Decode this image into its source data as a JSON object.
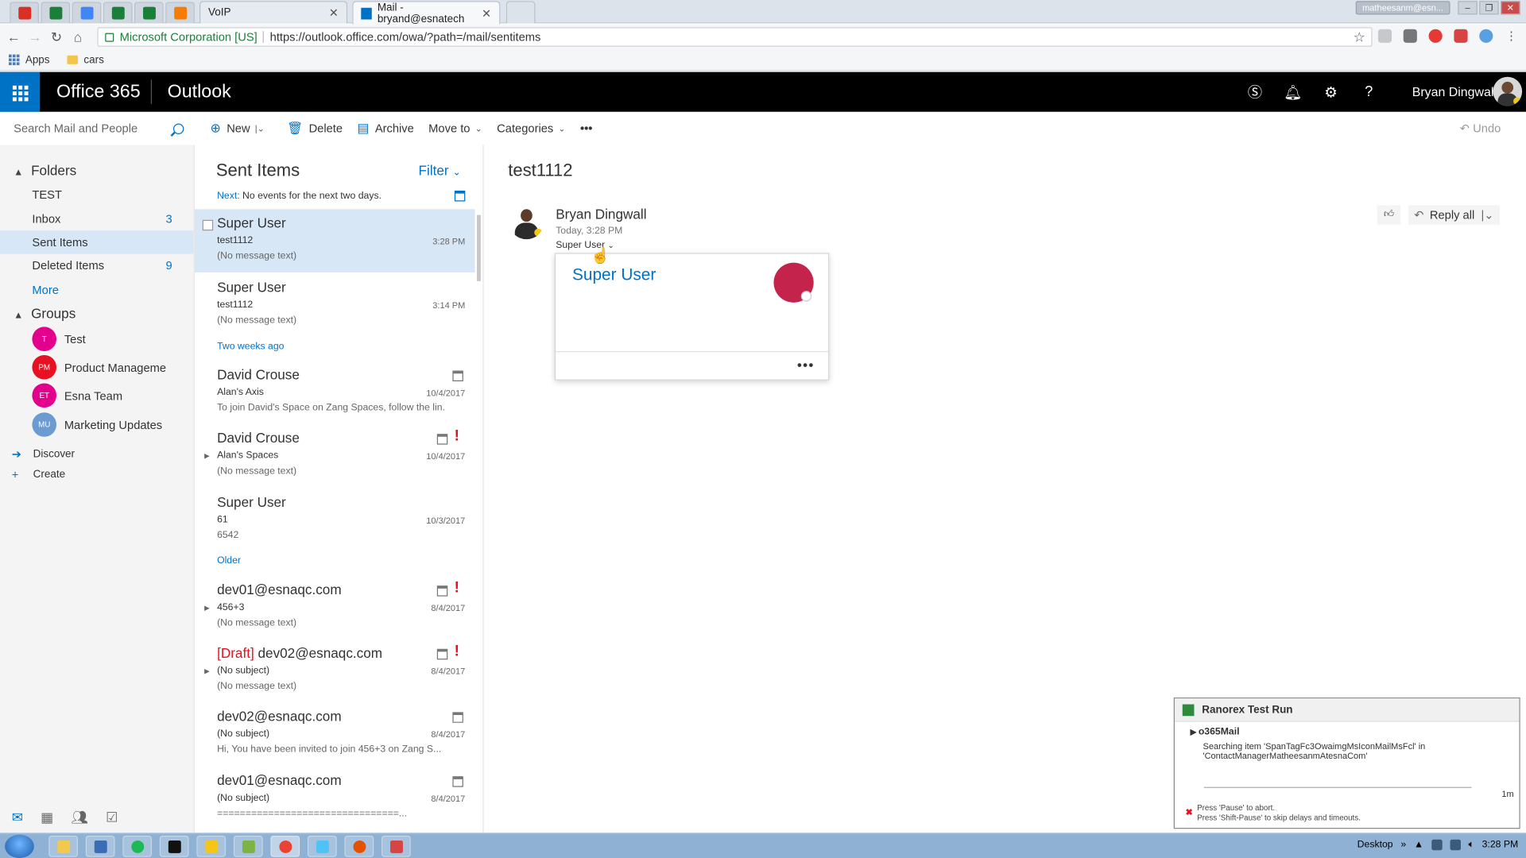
{
  "browser": {
    "tabs": [
      {
        "label": "VoIP"
      },
      {
        "label": "Mail - bryand@esnatech"
      }
    ],
    "profile_chip": "matheesanm@esn...",
    "address": {
      "org": "Microsoft Corporation [US]",
      "url": "https://outlook.office.com/owa/?path=/mail/sentitems"
    },
    "bookmarks": {
      "apps": "Apps",
      "folder": "cars"
    }
  },
  "suite": {
    "brand": "Office 365",
    "app": "Outlook",
    "user_name": "Bryan Dingwall"
  },
  "commands": {
    "search_placeholder": "Search Mail and People",
    "new": "New",
    "delete": "Delete",
    "archive": "Archive",
    "move_to": "Move to",
    "categories": "Categories",
    "more": "•••",
    "undo": "Undo"
  },
  "nav": {
    "folders_header": "Folders",
    "folders": [
      {
        "label": "TEST",
        "count": ""
      },
      {
        "label": "Inbox",
        "count": "3"
      },
      {
        "label": "Sent Items",
        "count": ""
      },
      {
        "label": "Deleted Items",
        "count": "9"
      }
    ],
    "more": "More",
    "groups_header": "Groups",
    "groups": [
      {
        "initials": "T",
        "label": "Test",
        "color": "#e3008c"
      },
      {
        "initials": "PM",
        "label": "Product Manageme",
        "color": "#e81123"
      },
      {
        "initials": "ET",
        "label": "Esna Team",
        "color": "#e3008c"
      },
      {
        "initials": "MU",
        "label": "Marketing Updates",
        "color": "#6b9bd1"
      }
    ],
    "discover": "Discover",
    "create": "Create"
  },
  "list": {
    "title": "Sent Items",
    "filter": "Filter",
    "next_label": "Next:",
    "next_text": "No events for the next two days.",
    "sections": {
      "two_weeks": "Two weeks ago",
      "older": "Older"
    },
    "messages": [
      {
        "from": "Super User",
        "subject": "test1112",
        "preview": "(No message text)",
        "date": "3:28 PM"
      },
      {
        "from": "Super User",
        "subject": "test1112",
        "preview": "(No message text)",
        "date": "3:14 PM"
      },
      {
        "from": "David Crouse",
        "subject": "Alan's Axis",
        "preview": "To join David's Space on Zang Spaces, follow the lin...",
        "date": "10/4/2017"
      },
      {
        "from": "David Crouse",
        "subject": "Alan's Spaces",
        "preview": "(No message text)",
        "date": "10/4/2017"
      },
      {
        "from": "Super User",
        "subject": "61",
        "preview": "6542",
        "date": "10/3/2017"
      },
      {
        "from": "dev01@esnaqc.com",
        "subject": "456+3",
        "preview": "(No message text)",
        "date": "8/4/2017"
      },
      {
        "draft": "[Draft]",
        "from": "dev02@esnaqc.com",
        "subject": "(No subject)",
        "preview": "(No message text)",
        "date": "8/4/2017"
      },
      {
        "from": "dev02@esnaqc.com",
        "subject": "(No subject)",
        "preview": "Hi, You have been invited to join 456+3 on Zang S...",
        "date": "8/4/2017"
      },
      {
        "from": "dev01@esnaqc.com",
        "subject": "(No subject)",
        "preview": "================================...",
        "date": "8/4/2017"
      }
    ]
  },
  "reading": {
    "subject": "test1112",
    "sender": "Bryan Dingwall",
    "date": "Today, 3:28 PM",
    "to": "Super User",
    "reply_all": "Reply all",
    "card": {
      "name": "Super User",
      "more": "•••"
    }
  },
  "ranorex": {
    "title": "Ranorex Test Run",
    "test_name": "o365Mail",
    "message": "Searching item 'SpanTagFc3OwaimgMsIconMailMsFcl' in 'ContactManagerMatheesanmAtesnaCom'",
    "limit": "1m",
    "footer1": "Press 'Pause' to abort.",
    "footer2": "Press 'Shift-Pause' to skip delays and timeouts."
  },
  "taskbar": {
    "desktop": "Desktop",
    "time": "3:28 PM"
  }
}
